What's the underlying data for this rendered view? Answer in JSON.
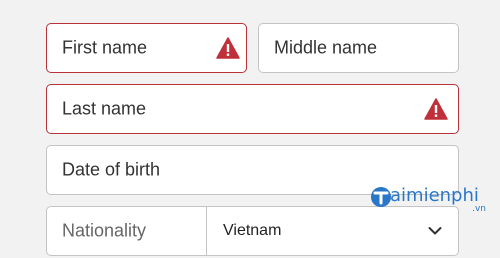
{
  "form": {
    "first_name": {
      "placeholder": "First name",
      "has_error": true
    },
    "middle_name": {
      "placeholder": "Middle name",
      "has_error": false
    },
    "last_name": {
      "placeholder": "Last name",
      "has_error": true
    },
    "date_of_birth": {
      "placeholder": "Date of birth",
      "has_error": false
    },
    "nationality": {
      "label": "Nationality",
      "selected_value": "Vietnam",
      "icon": "chevron-down-icon"
    }
  },
  "icons": {
    "error": "warning-icon"
  },
  "colors": {
    "error_border": "#b8323a",
    "error_icon": "#c0303a",
    "default_border": "#c4c4c4",
    "background": "#f2f2f2",
    "watermark": "#2a77c8"
  },
  "watermark": {
    "text": "aimienphi",
    "suffix": ".vn"
  }
}
